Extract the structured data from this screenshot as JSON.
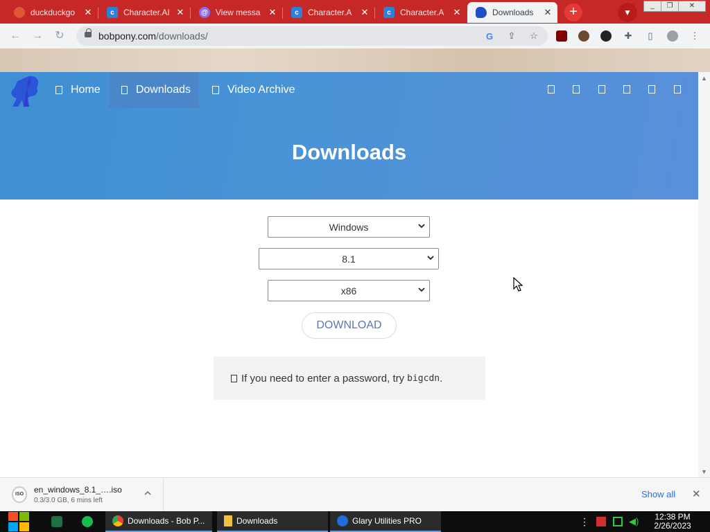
{
  "browser": {
    "tabs": [
      {
        "title": "duckduckgo",
        "favicon": "duckduckgo-icon",
        "color": "#de5833"
      },
      {
        "title": "Character.AI",
        "favicon": "character-ai-icon",
        "color": "#2f80d8"
      },
      {
        "title": "View messa",
        "favicon": "mastodon-icon",
        "color": "#8c6cf0"
      },
      {
        "title": "Character.A",
        "favicon": "character-ai-icon",
        "color": "#2f80d8"
      },
      {
        "title": "Character.A",
        "favicon": "character-ai-icon",
        "color": "#2f80d8"
      },
      {
        "title": "Downloads",
        "favicon": "bobpony-logo-icon",
        "color": "#1f4fc4"
      }
    ],
    "new_tab": "+",
    "url_host": "bobpony.com",
    "url_path": "/downloads/"
  },
  "site": {
    "nav": [
      {
        "label": "Home"
      },
      {
        "label": "Downloads"
      },
      {
        "label": "Video Archive"
      }
    ],
    "page_title": "Downloads",
    "header_colors": {
      "start": "#3f8fd4",
      "end": "#5a8fdb"
    }
  },
  "form": {
    "os": "Windows",
    "version": "8.1",
    "arch": "x86",
    "download_label": "DOWNLOAD",
    "note_text": "If you need to enter a password, try",
    "note_code": "bigcdn",
    "note_end": "."
  },
  "download_shelf": {
    "filename": "en_windows_8.1_….iso",
    "status": "0.3/3.0 GB, 6 mins left",
    "icon_text": "ISO",
    "show_all": "Show all"
  },
  "taskbar": {
    "apps": [
      {
        "label": "Downloads - Bob P...",
        "icon": "chrome-icon"
      },
      {
        "label": "Downloads",
        "icon": "folder-icon"
      },
      {
        "label": "Glary Utilities PRO",
        "icon": "glary-utilities-icon"
      }
    ],
    "time": "12:38 PM",
    "date": "2/26/2023"
  }
}
